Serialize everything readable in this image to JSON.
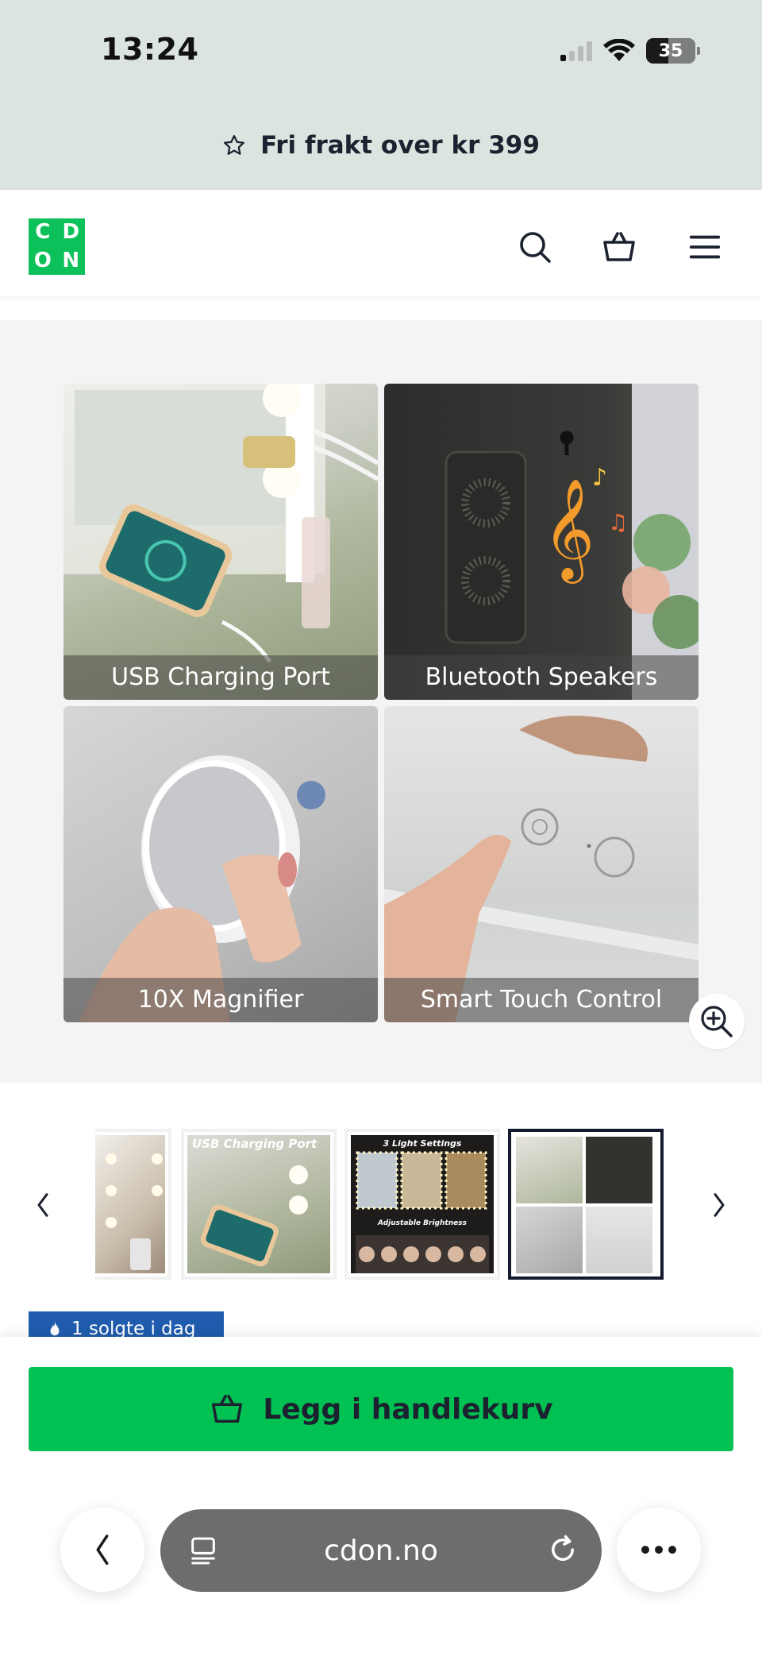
{
  "status_bar": {
    "time": "13:24",
    "battery": "35",
    "signal_bars_on": 1,
    "signal_bars_total": 4,
    "icons": [
      "signal-icon",
      "wifi-icon",
      "battery-icon"
    ]
  },
  "promo": {
    "icon": "star-icon",
    "text": "Fri frakt over kr 399"
  },
  "header": {
    "logo_letters": [
      "C",
      "D",
      "O",
      "N"
    ],
    "logo_color": "#0dc15a",
    "icons": [
      "search-icon",
      "basket-icon",
      "menu-icon"
    ]
  },
  "gallery": {
    "tiles": [
      {
        "caption": "USB Charging Port"
      },
      {
        "caption": "Bluetooth Speakers"
      },
      {
        "caption": "10X Magnifier"
      },
      {
        "caption": "Smart Touch Control"
      }
    ],
    "zoom_icon": "zoom-in-icon"
  },
  "thumbnails": {
    "prev_icon": "chevron-left-icon",
    "next_icon": "chevron-right-icon",
    "items": [
      {
        "label": ""
      },
      {
        "label": "USB Charging Port"
      },
      {
        "label": "3 Light Settings",
        "sublabel": "Adjustable Brightness"
      },
      {
        "label": ""
      }
    ],
    "active_index": 3
  },
  "sold_badge": {
    "icon": "flame-icon",
    "text": "1 solgte i dag",
    "color": "#1f5cae"
  },
  "cart": {
    "button_label": "Legg i handlekurv",
    "button_color": "#00c152",
    "icon": "basket-icon"
  },
  "browser": {
    "url": "cdon.no",
    "icons": [
      "back-icon",
      "tabs-icon",
      "reload-icon",
      "more-icon"
    ]
  }
}
